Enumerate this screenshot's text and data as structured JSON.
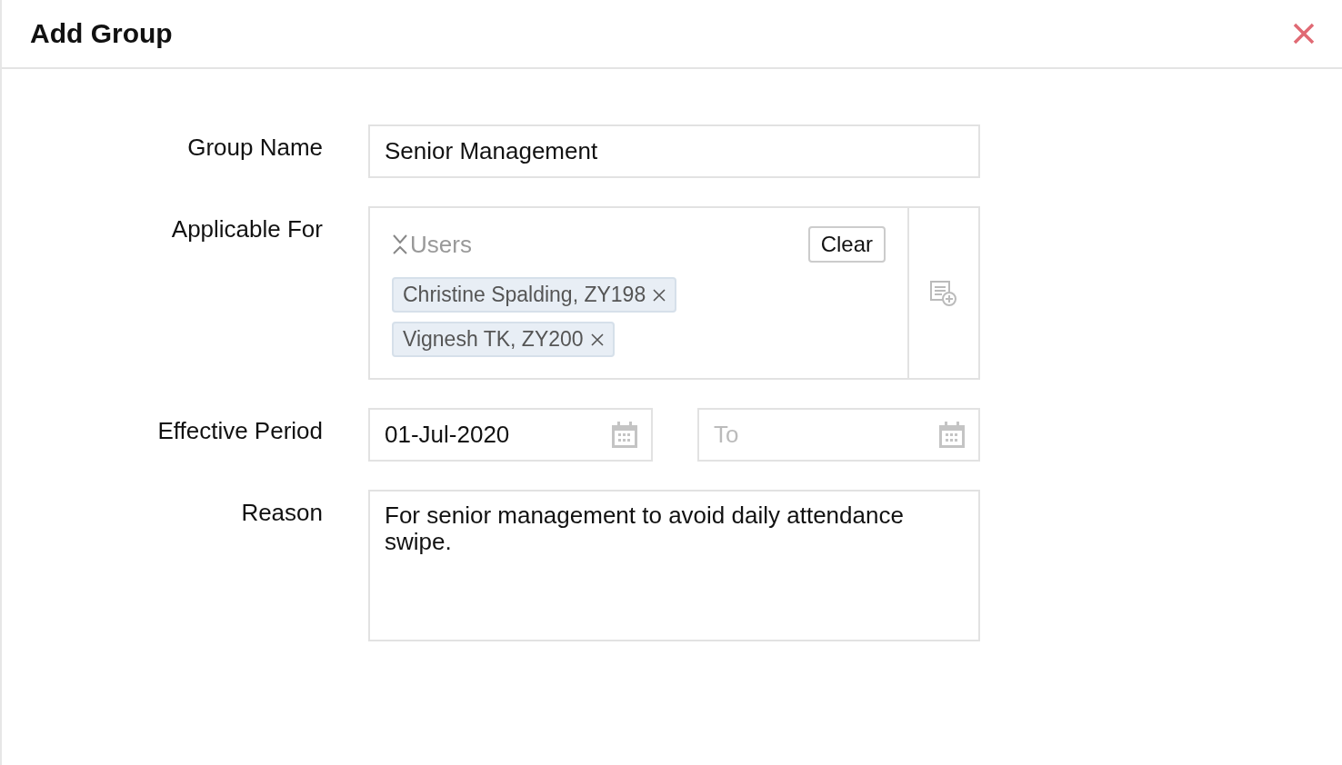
{
  "title": "Add Group",
  "group_name": {
    "label": "Group Name",
    "value": "Senior Management"
  },
  "applicable_for": {
    "label": "Applicable For",
    "section": "Users",
    "clear_button": "Clear",
    "tags": [
      {
        "text": "Christine Spalding, ZY198"
      },
      {
        "text": "Vignesh TK, ZY200"
      }
    ]
  },
  "effective_period": {
    "label": "Effective Period",
    "from": {
      "value": "01-Jul-2020"
    },
    "to": {
      "placeholder": "To"
    }
  },
  "reason": {
    "label": "Reason",
    "value": "For senior management to avoid daily attendance swipe."
  }
}
